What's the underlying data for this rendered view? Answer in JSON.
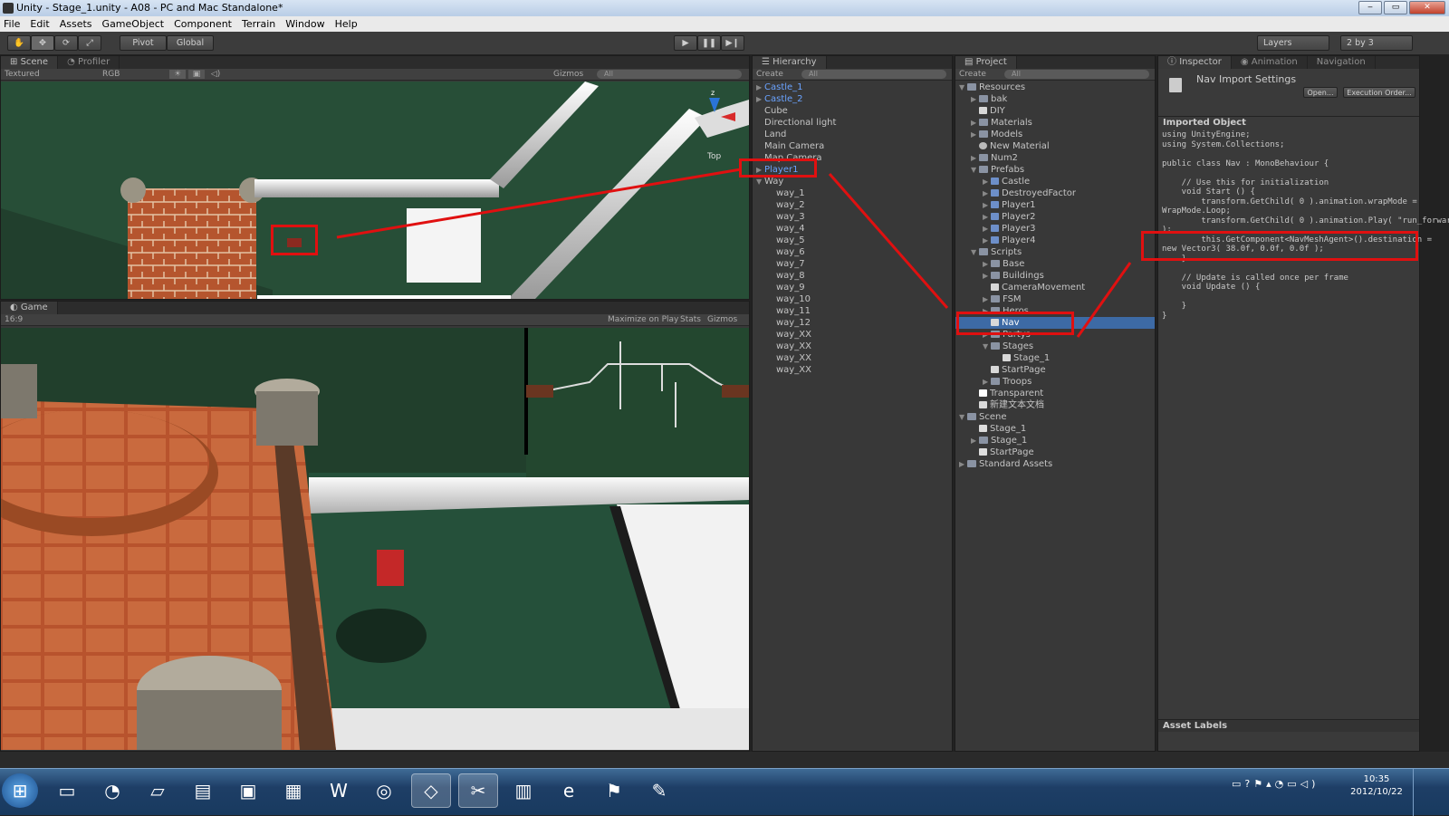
{
  "window": {
    "title": "Unity - Stage_1.unity - A08 - PC and Mac Standalone*",
    "buttons": [
      "‒",
      "▭",
      "✕"
    ]
  },
  "menu": [
    "File",
    "Edit",
    "Assets",
    "GameObject",
    "Component",
    "Terrain",
    "Window",
    "Help"
  ],
  "toolbar": {
    "pivot": "Pivot",
    "global": "Global",
    "layers": "Layers",
    "layout": "2 by 3"
  },
  "scene": {
    "tab": "Scene",
    "tab2": "Profiler",
    "render_mode": "Textured",
    "color_mode": "RGB",
    "gizmos": "Gizmos",
    "search": "All",
    "gizmo_axis": "z",
    "gizmo_view": "Top"
  },
  "game": {
    "tab": "Game",
    "aspect": "16:9",
    "maximize": "Maximize on Play",
    "stats": "Stats",
    "gizmos": "Gizmos"
  },
  "hierarchy": {
    "tab": "Hierarchy",
    "create": "Create",
    "search": "All",
    "items": [
      {
        "label": "Castle_1",
        "blue": true,
        "arrow": true,
        "indent": 0
      },
      {
        "label": "Castle_2",
        "blue": true,
        "arrow": true,
        "indent": 0
      },
      {
        "label": "Cube",
        "blue": false,
        "arrow": false,
        "indent": 0
      },
      {
        "label": "Directional light",
        "blue": false,
        "arrow": false,
        "indent": 0
      },
      {
        "label": "Land",
        "blue": false,
        "arrow": false,
        "indent": 0
      },
      {
        "label": "Main Camera",
        "blue": false,
        "arrow": false,
        "indent": 0
      },
      {
        "label": "Map Camera",
        "blue": false,
        "arrow": false,
        "indent": 0
      },
      {
        "label": "Player1",
        "blue": true,
        "arrow": true,
        "indent": 0
      },
      {
        "label": "Way",
        "blue": false,
        "arrow": true,
        "open": true,
        "indent": 0
      },
      {
        "label": "way_1",
        "indent": 1
      },
      {
        "label": "way_2",
        "indent": 1
      },
      {
        "label": "way_3",
        "indent": 1
      },
      {
        "label": "way_4",
        "indent": 1
      },
      {
        "label": "way_5",
        "indent": 1
      },
      {
        "label": "way_6",
        "indent": 1
      },
      {
        "label": "way_7",
        "indent": 1
      },
      {
        "label": "way_8",
        "indent": 1
      },
      {
        "label": "way_9",
        "indent": 1
      },
      {
        "label": "way_10",
        "indent": 1
      },
      {
        "label": "way_11",
        "indent": 1
      },
      {
        "label": "way_12",
        "indent": 1
      },
      {
        "label": "way_XX",
        "indent": 1
      },
      {
        "label": "way_XX",
        "indent": 1
      },
      {
        "label": "way_XX",
        "indent": 1
      },
      {
        "label": "way_XX",
        "indent": 1
      }
    ]
  },
  "project": {
    "tab": "Project",
    "create": "Create",
    "search": "All",
    "items": [
      {
        "label": "Resources",
        "indent": 0,
        "arrow": "open",
        "icon": "folder"
      },
      {
        "label": "bak",
        "indent": 1,
        "arrow": "closed",
        "icon": "folder"
      },
      {
        "label": "DIY",
        "indent": 1,
        "arrow": "",
        "icon": "file"
      },
      {
        "label": "Materials",
        "indent": 1,
        "arrow": "closed",
        "icon": "folder"
      },
      {
        "label": "Models",
        "indent": 1,
        "arrow": "closed",
        "icon": "folder"
      },
      {
        "label": "New Material",
        "indent": 1,
        "arrow": "",
        "icon": "sphere"
      },
      {
        "label": "Num2",
        "indent": 1,
        "arrow": "closed",
        "icon": "folder"
      },
      {
        "label": "Prefabs",
        "indent": 1,
        "arrow": "open",
        "icon": "folder"
      },
      {
        "label": "Castle",
        "indent": 2,
        "arrow": "closed",
        "icon": "prefab"
      },
      {
        "label": "DestroyedFactor",
        "indent": 2,
        "arrow": "closed",
        "icon": "prefab"
      },
      {
        "label": "Player1",
        "indent": 2,
        "arrow": "closed",
        "icon": "prefab"
      },
      {
        "label": "Player2",
        "indent": 2,
        "arrow": "closed",
        "icon": "prefab"
      },
      {
        "label": "Player3",
        "indent": 2,
        "arrow": "closed",
        "icon": "prefab"
      },
      {
        "label": "Player4",
        "indent": 2,
        "arrow": "closed",
        "icon": "prefab"
      },
      {
        "label": "Scripts",
        "indent": 1,
        "arrow": "open",
        "icon": "folder"
      },
      {
        "label": "Base",
        "indent": 2,
        "arrow": "closed",
        "icon": "folder"
      },
      {
        "label": "Buildings",
        "indent": 2,
        "arrow": "closed",
        "icon": "folder"
      },
      {
        "label": "CameraMovement",
        "indent": 2,
        "arrow": "",
        "icon": "file"
      },
      {
        "label": "FSM",
        "indent": 2,
        "arrow": "closed",
        "icon": "folder"
      },
      {
        "label": "Heros",
        "indent": 2,
        "arrow": "closed",
        "icon": "folder"
      },
      {
        "label": "Nav",
        "indent": 2,
        "arrow": "",
        "icon": "file",
        "selected": true
      },
      {
        "label": "Partys",
        "indent": 2,
        "arrow": "closed",
        "icon": "folder"
      },
      {
        "label": "Stages",
        "indent": 2,
        "arrow": "open",
        "icon": "folder"
      },
      {
        "label": "Stage_1",
        "indent": 3,
        "arrow": "",
        "icon": "file"
      },
      {
        "label": "StartPage",
        "indent": 2,
        "arrow": "",
        "icon": "file"
      },
      {
        "label": "Troops",
        "indent": 2,
        "arrow": "closed",
        "icon": "folder"
      },
      {
        "label": "Transparent",
        "indent": 1,
        "arrow": "",
        "icon": "white"
      },
      {
        "label": "新建文本文档",
        "indent": 1,
        "arrow": "",
        "icon": "file"
      },
      {
        "label": "Scene",
        "indent": 0,
        "arrow": "open",
        "icon": "folder"
      },
      {
        "label": "Stage_1",
        "indent": 1,
        "arrow": "",
        "icon": "unity"
      },
      {
        "label": "Stage_1",
        "indent": 1,
        "arrow": "closed",
        "icon": "folder"
      },
      {
        "label": "StartPage",
        "indent": 1,
        "arrow": "",
        "icon": "unity"
      },
      {
        "label": "Standard Assets",
        "indent": 0,
        "arrow": "closed",
        "icon": "folder"
      }
    ]
  },
  "inspector": {
    "tab": "Inspector",
    "tab2": "Animation",
    "tab3": "Navigation",
    "title": "Nav Import Settings",
    "open_btn": "Open...",
    "exec_btn": "Execution Order...",
    "imported_label": "Imported Object",
    "code": "using UnityEngine;\nusing System.Collections;\n\npublic class Nav : MonoBehaviour {\n\n    // Use this for initialization\n    void Start () {\n        transform.GetChild( 0 ).animation.wrapMode =\nWrapMode.Loop;\n        transform.GetChild( 0 ).animation.Play( \"run_forward\"\n);\n        this.GetComponent<NavMeshAgent>().destination =\nnew Vector3( 38.0f, 0.0f, 0.0f );\n    }\n\n    // Update is called once per frame\n    void Update () {\n\n    }\n}",
    "asset_labels": "Asset Labels"
  },
  "taskbar": {
    "time": "10:35",
    "date": "2012/10/22"
  }
}
